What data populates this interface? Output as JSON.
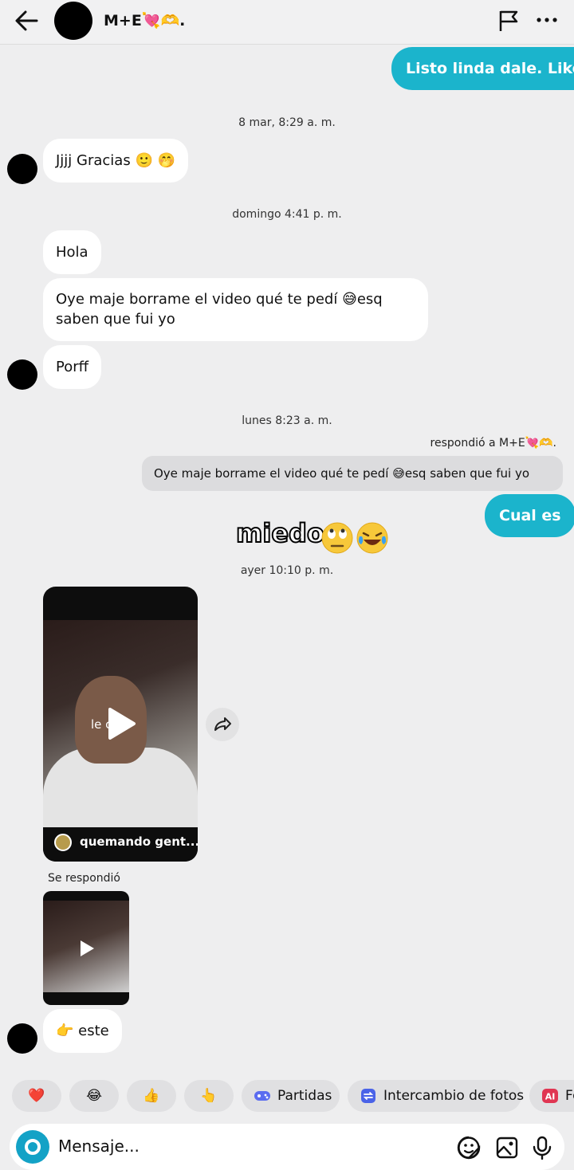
{
  "header": {
    "title": "M+E💘🫶.",
    "back_icon": "arrow-left-icon",
    "flag_icon": "flag-icon",
    "more_icon": "more-icon"
  },
  "messages": {
    "out_1": "Listo linda dale. Like",
    "ts_1": "8 mar, 8:29 a. m.",
    "in_1": "Jjjj Gracias 🙂 🤭",
    "ts_2": "domingo 4:41 p. m.",
    "in_2": "Hola",
    "in_3_line1": "Oye maje borrame   el video  qué  te pedí     😅esq",
    "in_3_line2": "saben que   fui yo",
    "in_4": "Porff",
    "ts_3": "lunes 8:23 a. m.",
    "reply_label": "respondió a M+E💘🫶.",
    "reply_quote": "Oye maje borrame   el video  qué  te pedí    😅esq saben que   fui yo",
    "out_2": "Cual es",
    "sticker_text": "miedo",
    "ts_4": "ayer 10:10 p. m.",
    "video_title": "quemando gent...",
    "video_overlay": "le c     tu",
    "self_replied": "Se respondió",
    "in_5": "👉 este"
  },
  "chips": [
    {
      "label": "❤️"
    },
    {
      "label": "😂"
    },
    {
      "label": "👍"
    },
    {
      "label": "👆"
    },
    {
      "label": "Partidas"
    },
    {
      "label": "Intercambio de fotos"
    },
    {
      "label": "Fo"
    }
  ],
  "composer": {
    "placeholder": "Mensaje..."
  },
  "colors": {
    "accent": "#1bb4cc",
    "background": "#eeeeef"
  }
}
